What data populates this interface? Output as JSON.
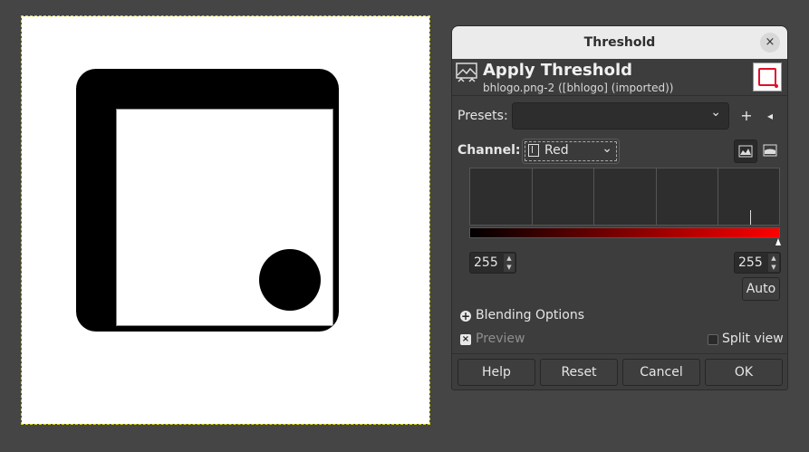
{
  "dialog": {
    "window_title": "Threshold",
    "close_glyph": "×",
    "title": "Apply Threshold",
    "subtitle": "bhlogo.png-2 ([bhlogo] (imported))",
    "presets_label": "Presets:",
    "presets_value": "",
    "add_preset_glyph": "+",
    "preset_menu_glyph": "◂",
    "channel_label": "Channel:",
    "channel_value": "Red",
    "low_value": "255",
    "high_value": "255",
    "auto_label": "Auto",
    "blending_label": "Blending Options",
    "preview_label": "Preview",
    "split_view_label": "Split view",
    "buttons": {
      "help": "Help",
      "reset": "Reset",
      "cancel": "Cancel",
      "ok": "OK"
    },
    "chevron_glyph": "⌄",
    "check_glyph": "×",
    "plus_glyph": "+"
  },
  "icons": {
    "close": "close-icon",
    "threshold": "threshold-icon",
    "image_thumbnail": "image-thumbnail-icon",
    "linear_histogram": "linear-histogram-icon",
    "log_histogram": "log-histogram-icon"
  },
  "colors": {
    "accent_red": "#e0102a",
    "gradient_start": "#000000",
    "gradient_end": "#ff0000"
  }
}
